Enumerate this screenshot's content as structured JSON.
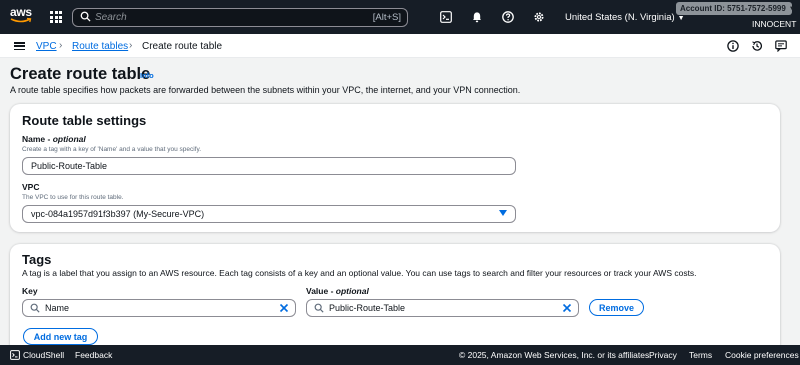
{
  "topnav": {
    "logo_text": "aws",
    "search_placeholder": "Search",
    "search_shortcut": "[Alt+S]",
    "region": "United States (N. Virginia)",
    "account": "Account ID: 5751-7572-5999",
    "user": "INNOCENT"
  },
  "breadcrumb": {
    "items": [
      "VPC",
      "Route tables",
      "Create route table"
    ]
  },
  "page": {
    "title": "Create route table",
    "info": "Info",
    "description": "A route table specifies how packets are forwarded between the subnets within your VPC, the internet, and your VPN connection."
  },
  "settings": {
    "title": "Route table settings",
    "name_label": "Name",
    "name_optional": "optional",
    "name_hint": "Create a tag with a key of 'Name' and a value that you specify.",
    "name_value": "Public-Route-Table",
    "vpc_label": "VPC",
    "vpc_hint": "The VPC to use for this route table.",
    "vpc_value": "vpc-084a1957d91f3b397 (My-Secure-VPC)"
  },
  "tags": {
    "title": "Tags",
    "description": "A tag is a label that you assign to an AWS resource. Each tag consists of a key and an optional value. You can use tags to search and filter your resources or track your AWS costs.",
    "key_label": "Key",
    "value_label": "Value",
    "value_optional": "optional",
    "key_value": "Name",
    "value_value": "Public-Route-Table",
    "remove_label": "Remove",
    "add_label": "Add new tag"
  },
  "footer": {
    "cloudshell": "CloudShell",
    "feedback": "Feedback",
    "copyright": "© 2025, Amazon Web Services, Inc. or its affiliates.",
    "privacy": "Privacy",
    "terms": "Terms",
    "cookies": "Cookie preferences"
  },
  "colors": {
    "nav_bg": "#161d26",
    "link": "#006ce0",
    "page_bg": "#f2f3f3"
  },
  "icons": [
    "grid-icon",
    "search-icon",
    "cloudshell-icon",
    "bell-icon",
    "help-icon",
    "gear-icon",
    "menu-icon",
    "info-icon",
    "history-icon",
    "feedback-icon",
    "clear-icon",
    "dropdown-caret-icon"
  ]
}
